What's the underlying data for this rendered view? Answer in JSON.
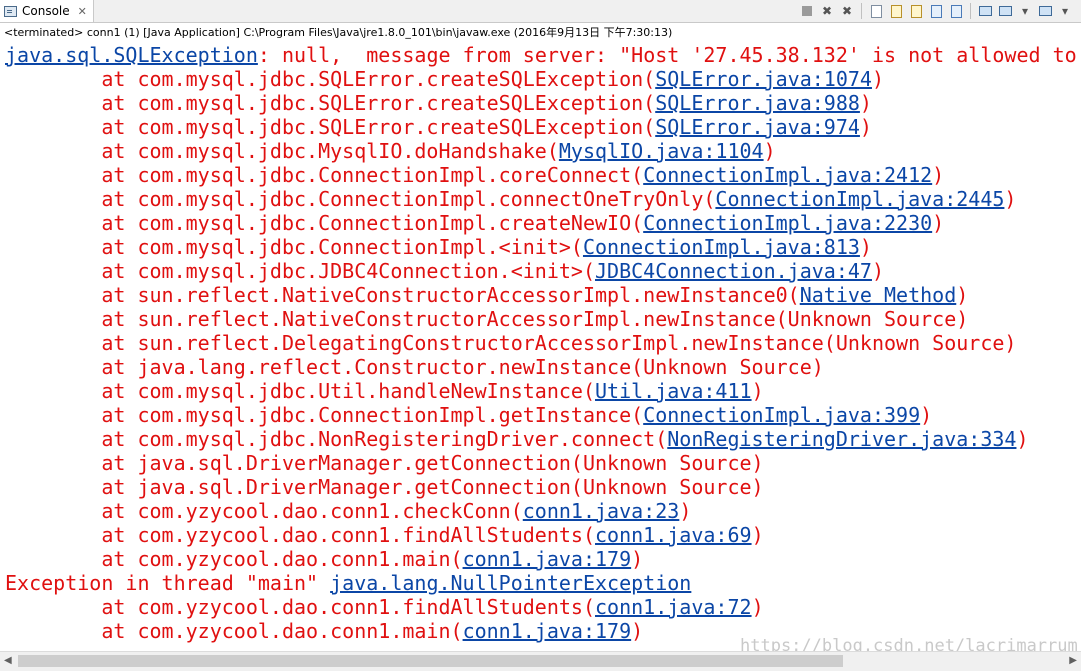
{
  "tab": {
    "label": "Console",
    "close": "✕"
  },
  "status_text": "<terminated> conn1 (1) [Java Application] C:\\Program Files\\Java\\jre1.8.0_101\\bin\\javaw.exe (2016年9月13日 下午7:30:13)",
  "watermark": "https://blog.csdn.net/lacrimarrum",
  "lines": [
    {
      "indent": "",
      "text": "",
      "link": "java.sql.SQLException",
      "after": ": null,  message from server: \"Host '27.45.38.132' is not allowed to"
    },
    {
      "indent": "        ",
      "text": "at com.mysql.jdbc.SQLError.createSQLException(",
      "link": "SQLError.java:1074",
      "after": ")"
    },
    {
      "indent": "        ",
      "text": "at com.mysql.jdbc.SQLError.createSQLException(",
      "link": "SQLError.java:988",
      "after": ")"
    },
    {
      "indent": "        ",
      "text": "at com.mysql.jdbc.SQLError.createSQLException(",
      "link": "SQLError.java:974",
      "after": ")"
    },
    {
      "indent": "        ",
      "text": "at com.mysql.jdbc.MysqlIO.doHandshake(",
      "link": "MysqlIO.java:1104",
      "after": ")"
    },
    {
      "indent": "        ",
      "text": "at com.mysql.jdbc.ConnectionImpl.coreConnect(",
      "link": "ConnectionImpl.java:2412",
      "after": ")"
    },
    {
      "indent": "        ",
      "text": "at com.mysql.jdbc.ConnectionImpl.connectOneTryOnly(",
      "link": "ConnectionImpl.java:2445",
      "after": ")"
    },
    {
      "indent": "        ",
      "text": "at com.mysql.jdbc.ConnectionImpl.createNewIO(",
      "link": "ConnectionImpl.java:2230",
      "after": ")"
    },
    {
      "indent": "        ",
      "text": "at com.mysql.jdbc.ConnectionImpl.<init>(",
      "link": "ConnectionImpl.java:813",
      "after": ")"
    },
    {
      "indent": "        ",
      "text": "at com.mysql.jdbc.JDBC4Connection.<init>(",
      "link": "JDBC4Connection.java:47",
      "after": ")"
    },
    {
      "indent": "        ",
      "text": "at sun.reflect.NativeConstructorAccessorImpl.newInstance0(",
      "link": "Native Method",
      "after": ")"
    },
    {
      "indent": "        ",
      "text": "at sun.reflect.NativeConstructorAccessorImpl.newInstance(Unknown Source)",
      "link": "",
      "after": ""
    },
    {
      "indent": "        ",
      "text": "at sun.reflect.DelegatingConstructorAccessorImpl.newInstance(Unknown Source)",
      "link": "",
      "after": ""
    },
    {
      "indent": "        ",
      "text": "at java.lang.reflect.Constructor.newInstance(Unknown Source)",
      "link": "",
      "after": ""
    },
    {
      "indent": "        ",
      "text": "at com.mysql.jdbc.Util.handleNewInstance(",
      "link": "Util.java:411",
      "after": ")"
    },
    {
      "indent": "        ",
      "text": "at com.mysql.jdbc.ConnectionImpl.getInstance(",
      "link": "ConnectionImpl.java:399",
      "after": ")"
    },
    {
      "indent": "        ",
      "text": "at com.mysql.jdbc.NonRegisteringDriver.connect(",
      "link": "NonRegisteringDriver.java:334",
      "after": ")"
    },
    {
      "indent": "        ",
      "text": "at java.sql.DriverManager.getConnection(Unknown Source)",
      "link": "",
      "after": ""
    },
    {
      "indent": "        ",
      "text": "at java.sql.DriverManager.getConnection(Unknown Source)",
      "link": "",
      "after": ""
    },
    {
      "indent": "        ",
      "text": "at com.yzycool.dao.conn1.checkConn(",
      "link": "conn1.java:23",
      "after": ")"
    },
    {
      "indent": "        ",
      "text": "at com.yzycool.dao.conn1.findAllStudents(",
      "link": "conn1.java:69",
      "after": ")"
    },
    {
      "indent": "        ",
      "text": "at com.yzycool.dao.conn1.main(",
      "link": "conn1.java:179",
      "after": ")"
    },
    {
      "indent": "",
      "text": "Exception in thread \"main\" ",
      "link": "java.lang.NullPointerException",
      "after": ""
    },
    {
      "indent": "        ",
      "text": "at com.yzycool.dao.conn1.findAllStudents(",
      "link": "conn1.java:72",
      "after": ")"
    },
    {
      "indent": "        ",
      "text": "at com.yzycool.dao.conn1.main(",
      "link": "conn1.java:179",
      "after": ")"
    }
  ]
}
